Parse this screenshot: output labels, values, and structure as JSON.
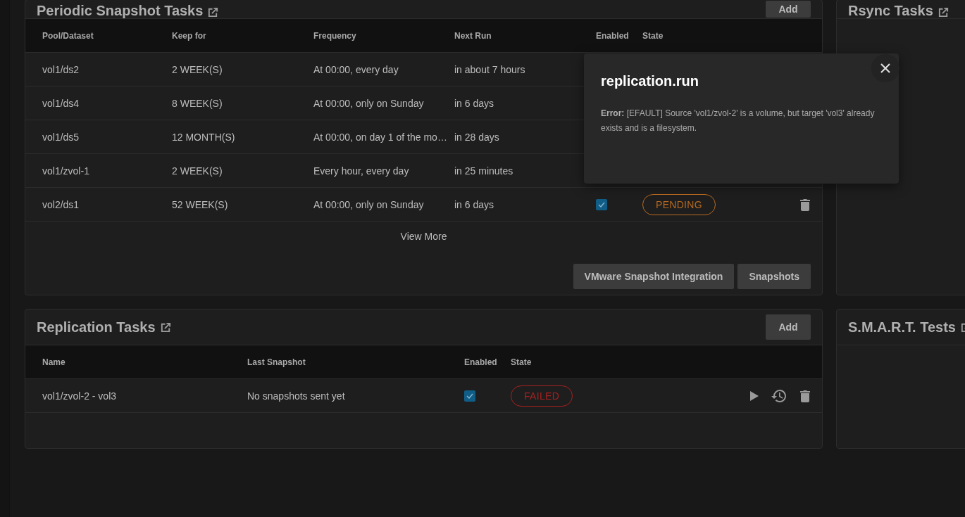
{
  "periodic_snapshot_tasks": {
    "title": "Periodic Snapshot Tasks",
    "add_button": "Add",
    "columns": [
      "Pool/Dataset",
      "Keep for",
      "Frequency",
      "Next Run",
      "Enabled",
      "State"
    ],
    "rows": [
      {
        "pool_dataset": "vol1/ds2",
        "keep_for": "2 WEEK(S)",
        "frequency": "At 00:00, every day",
        "next_run": "in about 7 hours"
      },
      {
        "pool_dataset": "vol1/ds4",
        "keep_for": "8 WEEK(S)",
        "frequency": "At 00:00, only on Sunday",
        "next_run": "in 6 days"
      },
      {
        "pool_dataset": "vol1/ds5",
        "keep_for": "12 MONTH(S)",
        "frequency": "At 00:00, on day 1 of the mo…",
        "next_run": "in 28 days"
      },
      {
        "pool_dataset": "vol1/zvol-1",
        "keep_for": "2 WEEK(S)",
        "frequency": "Every hour, every day",
        "next_run": "in 25 minutes"
      },
      {
        "pool_dataset": "vol2/ds1",
        "keep_for": "52 WEEK(S)",
        "frequency": "At 00:00, only on Sunday",
        "next_run": "in 6 days",
        "enabled": true,
        "state": "PENDING",
        "color": "#b86a20"
      }
    ],
    "view_more": "View More",
    "buttons": [
      "VMware Snapshot Integration",
      "Snapshots"
    ]
  },
  "rsync_tasks": {
    "title": "Rsync Tasks"
  },
  "replication_tasks": {
    "title": "Replication Tasks",
    "add_button": "Add",
    "columns": [
      "Name",
      "Last Snapshot",
      "Enabled",
      "State"
    ],
    "rows": [
      {
        "name": "vol1/zvol-2 - vol3",
        "last_snapshot": "No snapshots sent yet",
        "enabled": true,
        "state": "FAILED",
        "color": "#a82020"
      }
    ]
  },
  "smart_tests": {
    "title": "S.M.A.R.T. Tests"
  },
  "error_dialog": {
    "title": "replication.run",
    "message": "**Error:** [EFAULT] Source 'vol1/zvol-2' is a volume, but target 'vol3' already exists and is a filesystem."
  }
}
